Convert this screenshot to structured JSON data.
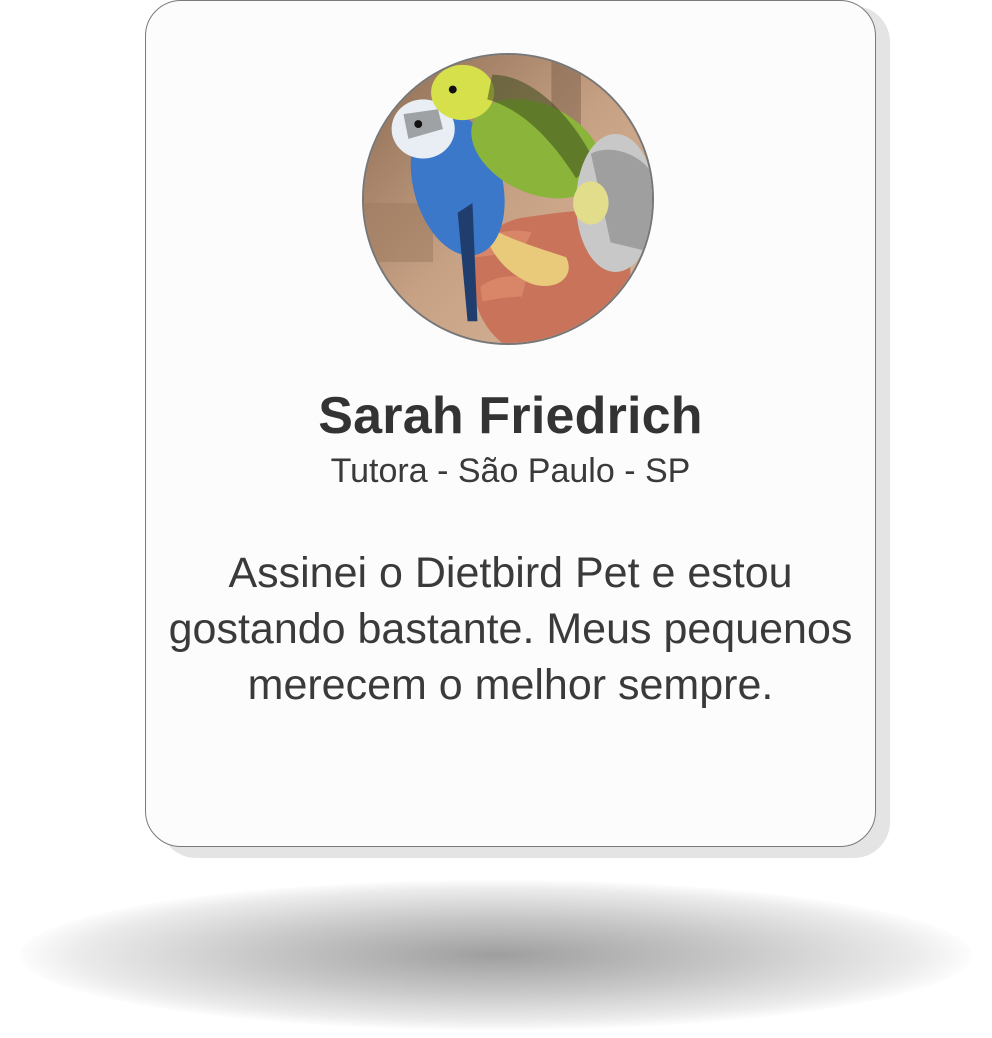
{
  "testimonial": {
    "name": "Sarah Friedrich",
    "role": "Tutora - São Paulo - SP",
    "quote_lines": [
      "Assinei o Dietbird Pet e estou",
      "gostando bastante. Meus pequenos",
      "merecem o melhor sempre."
    ],
    "photo_icon": "budgies-photo"
  }
}
